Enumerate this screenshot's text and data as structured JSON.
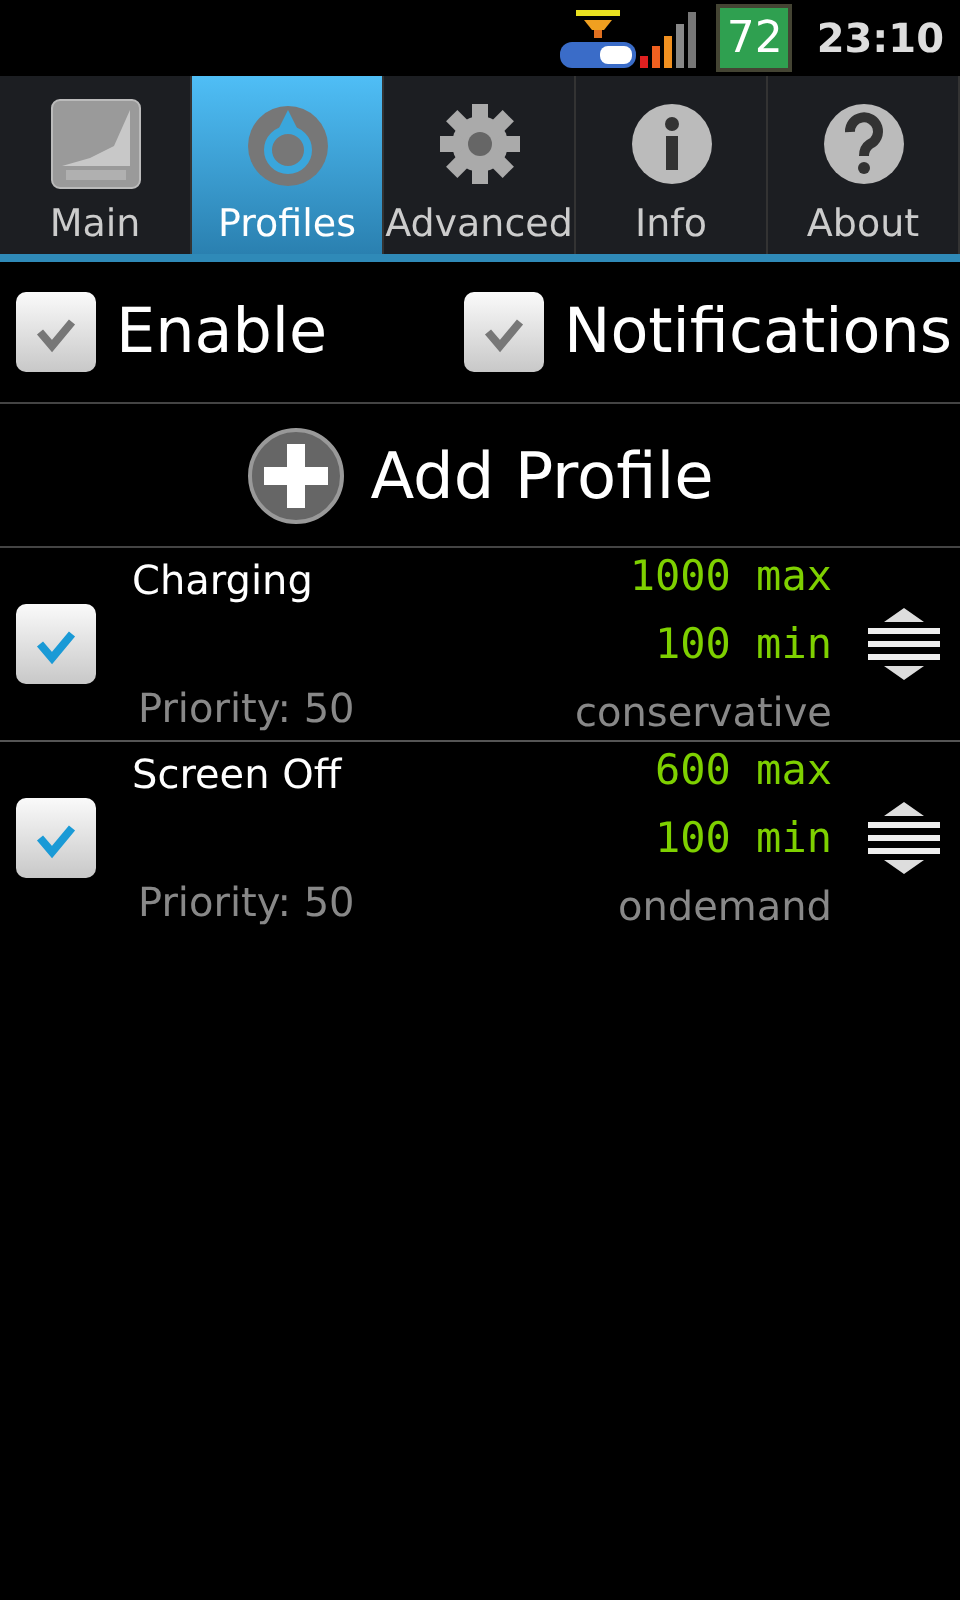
{
  "status_bar": {
    "battery": "72",
    "time": "23:10"
  },
  "tabs": [
    {
      "label": "Main",
      "kind": "setcpu",
      "selected": false
    },
    {
      "label": "Profiles",
      "kind": "profiles",
      "selected": true
    },
    {
      "label": "Advanced",
      "kind": "gear",
      "selected": false
    },
    {
      "label": "Info",
      "kind": "info",
      "selected": false
    },
    {
      "label": "About",
      "kind": "about",
      "selected": false
    }
  ],
  "options": [
    {
      "label": "Enable",
      "checked": true
    },
    {
      "label": "Notifications",
      "checked": true
    }
  ],
  "add_profile": {
    "label": "Add Profile"
  },
  "profiles": [
    {
      "name": "Charging",
      "checked": true,
      "max": "1000 max",
      "min": "100 min",
      "priority": "Priority: 50",
      "governor": "conservative"
    },
    {
      "name": "Screen Off",
      "checked": true,
      "max": "600 max",
      "min": "100 min",
      "priority": "Priority: 50",
      "governor": "ondemand"
    }
  ]
}
